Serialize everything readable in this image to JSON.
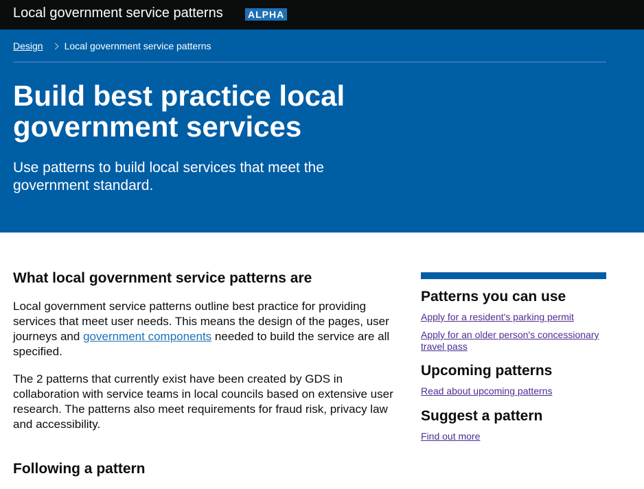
{
  "header": {
    "site_title": "Local government service patterns",
    "phase_tag": "ALPHA"
  },
  "breadcrumb": {
    "items": [
      {
        "label": "Design"
      },
      {
        "label": "Local government service patterns"
      }
    ]
  },
  "hero": {
    "title": "Build best practice local government services",
    "lede": "Use patterns to build local services that meet the government standard."
  },
  "main": {
    "heading_what": "What local government service patterns are",
    "p1_before_link": "Local government service patterns outline best practice for providing services that meet user needs. This means the design of the pages, user journeys and ",
    "p1_link": "government components",
    "p1_after_link": " needed to build the service are all specified.",
    "p2": "The 2 patterns that currently exist have been created by GDS in collaboration with service teams in local councils based on extensive user research. The patterns also meet requirements for fraud risk, privacy law and accessibility.",
    "heading_following": "Following a pattern"
  },
  "sidebar": {
    "patterns_heading": "Patterns you can use",
    "patterns_links": [
      {
        "label": "Apply for a resident's parking permit"
      },
      {
        "label": "Apply for an older person's concessionary travel pass"
      }
    ],
    "upcoming_heading": "Upcoming patterns",
    "upcoming_link": "Read about upcoming patterns",
    "suggest_heading": "Suggest a pattern",
    "suggest_link": "Find out more"
  },
  "colors": {
    "header_background": "#0b0c0c",
    "hero_background": "#005ea5",
    "phase_tag_background": "#1d70b8",
    "link": "#1d70b8",
    "visited_link": "#4c2c92",
    "text": "#0b0c0c"
  },
  "icons": {
    "breadcrumb_separator": "chevron-right-icon"
  }
}
